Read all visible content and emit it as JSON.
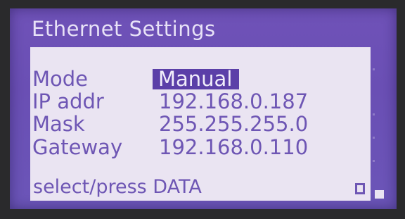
{
  "screen": {
    "title": "Ethernet Settings",
    "fields": [
      {
        "label": "Mode",
        "value": "Manual",
        "selected": true
      },
      {
        "label": "IP addr",
        "value": "192.168.0.187",
        "selected": false
      },
      {
        "label": "Mask",
        "value": "255.255.255.0",
        "selected": false
      },
      {
        "label": "Gateway",
        "value": "192.168.0.110",
        "selected": false
      }
    ],
    "prompt": "select/press DATA"
  },
  "colors": {
    "lcd_background": "#6b52b6",
    "panel_background": "#eae4f2",
    "text": "#6e56b4",
    "selection_highlight": "#5b3fa8"
  },
  "icons": {
    "status_box": "square-outline-icon",
    "corner_indicator": "filled-square-icon"
  }
}
